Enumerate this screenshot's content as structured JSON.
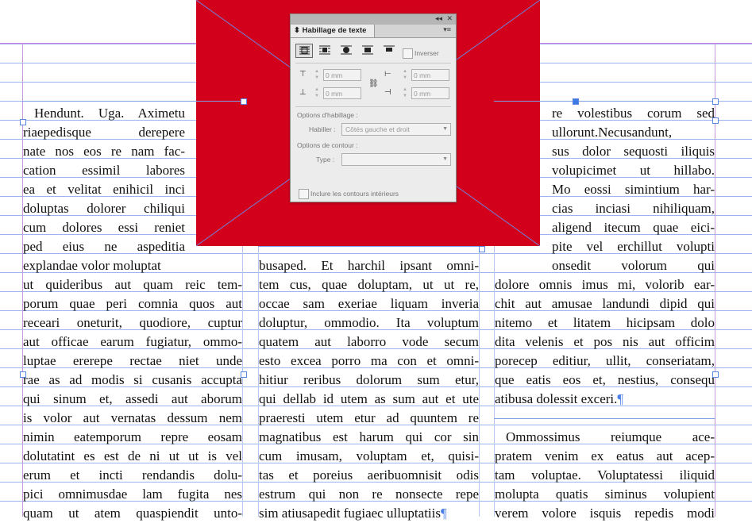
{
  "panel": {
    "title": "Habillage de texte",
    "tab_arrow": "⬍",
    "collapse": "◂◂",
    "close": "✕",
    "menu": "▾≡",
    "invert_label": "Inverser",
    "top_offset": "0 mm",
    "bottom_offset": "0 mm",
    "left_offset": "0 mm",
    "right_offset": "0 mm",
    "wrap_options_label": "Options d'habillage :",
    "wrap_to_label": "Habiller :",
    "wrap_to_value": "Côtés gauche et droit",
    "contour_options_label": "Options de contour :",
    "type_label": "Type :",
    "type_value": "",
    "include_inside_edges_label": "Inclure les contours intérieurs"
  },
  "columns": {
    "left_top": [
      "Hendunt. Uga. Aximetu",
      "riaepedisque derepere",
      "nate nos eos re nam fac-",
      "cation essimil labores",
      "ea et velitat enihicil inci",
      "doluptas dolorer chiliqui",
      "cum dolores essi reniet",
      "ped eius ne aspeditia",
      "explandae volor moluptat"
    ],
    "left_bottom": [
      "ut quideribus aut quam reic tem-",
      "porum quae peri comnia quos aut",
      "receari oneturit, quodiore, cuptur",
      "aut officae earum fugiatur, ommo-",
      "luptae ererepe rectae niet unde",
      "rae as ad modis si cusanis accupta",
      "qui sinum et, assedi aut aborum",
      "is volor aut vernatas dessum nem",
      "nimin eatemporum repre eosam",
      "dolutatint es est de ni ut ut is vel",
      "erum et incti rendandis dolu-",
      "pici omnimusdae lam fugita nes",
      "quam ut atem quaspiendit unto-"
    ],
    "middle": [
      "busaped. Et harchil ipsant omni-",
      "tem cus, quae doluptam, ut ut re,",
      "occae sam exeriae liquam inveria",
      "doluptur, ommodio. Ita voluptum",
      "quatem aut laborro vode secum",
      "esto excea porro ma con et omni-",
      "hitiur reribus dolorum sum etur,",
      "qui dellab id utem as sum aut et ute",
      "praeresti utem etur ad quuntem re",
      "magnatibus est harum qui cor sin",
      "cum imusam, voluptam et, quisi-",
      "tas et poreius aeribuomnisit odis",
      "estrum qui non re nonsecte repe",
      "sim atiusapedit fugiaec ulluptatiis"
    ],
    "right_top": [
      "re volestibus corum sed",
      "ullorunt.Necusandunt,",
      "sus dolor sequosti iliquis",
      "volupicimet ut hillabo.",
      "Mo eossi simintium har-",
      "cias inciasi nihiliquam,",
      "aligend itecum quae eici-",
      "pite vel erchillut volupti",
      "onsedit volorum qui"
    ],
    "right_bottom": [
      "dolore omnis imus mi, volorib ear-",
      "chit aut amusae landundi dipid qui",
      "nitemo et litatem hicipsam dolo",
      "dita velenis et pos nis aut officim",
      "porecep editiur, ullit, conseriatam,",
      "que eatis eos et, nestius, consequ",
      "atibusa dolessit exceri."
    ],
    "right_para2": [
      "Ommossimus reiumque ace-",
      "pratem venim ex eatus aut acep-",
      "tam voluptae. Voluptatessi iliquid",
      "molupta quatis siminus volupient",
      "verem volore isquis repedis modi"
    ],
    "pilcrow": "¶"
  },
  "colors": {
    "graphic_fill": "#d3001c",
    "baseline_grid": "#9cb4ec",
    "margin_guide": "#c89bd8",
    "frame_edge": "#5b86e3"
  }
}
